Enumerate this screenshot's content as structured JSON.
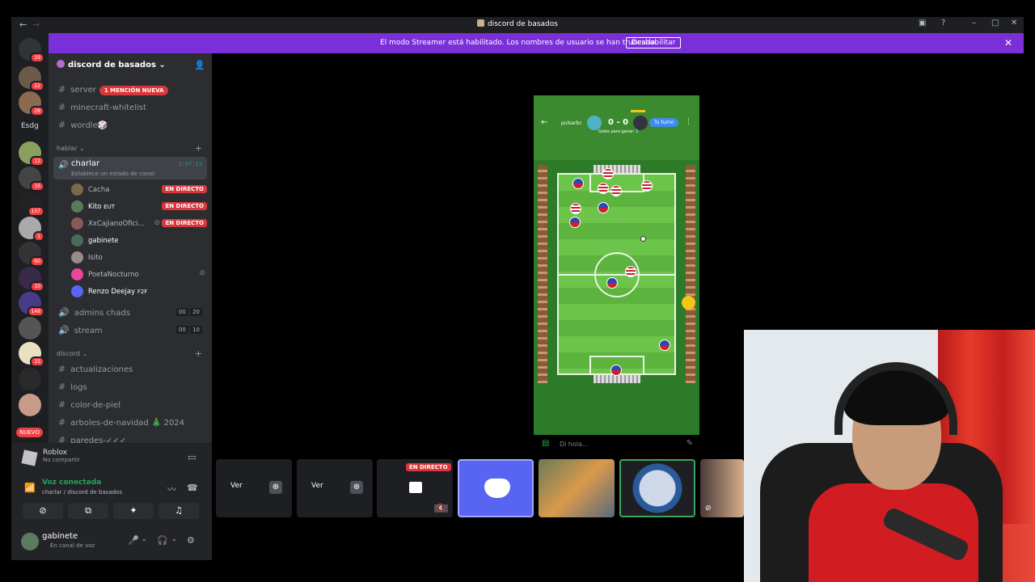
{
  "window": {
    "title": "discord de basados"
  },
  "banner": {
    "message": "El modo Streamer está habilitado. Los nombres de usuario se han truncado.",
    "button": "Deshabilitar"
  },
  "servers": {
    "badges": [
      "19",
      "22",
      "28",
      "12",
      "16",
      "157",
      "1",
      "60",
      "10",
      "148",
      "15"
    ],
    "text_item": "Esdg",
    "new_label": "NUEVO"
  },
  "guild": {
    "name": "discord de basados"
  },
  "channels": {
    "top": [
      {
        "name": "server",
        "mention": "1 MENCIÓN NUEVA"
      },
      {
        "name": "minecraft-whitelist"
      },
      {
        "name": "wordle🎲"
      }
    ],
    "category_hablar": "hablar",
    "voice_active": {
      "name": "charlar",
      "status": "Establece un estado de canal",
      "time": "1:07:21"
    },
    "voice_users": [
      {
        "name": "Cacha",
        "live": "EN DIRECTO"
      },
      {
        "name": "Kito",
        "tag": "EUT",
        "live": "EN DIRECTO"
      },
      {
        "name": "XxCajianoOfici...",
        "live": "EN DIRECTO"
      },
      {
        "name": "gabinete"
      },
      {
        "name": "Isito"
      },
      {
        "name": "PoetaNocturno"
      },
      {
        "name": "Renzo Deejay",
        "tag": "F2F"
      }
    ],
    "voice_others": [
      {
        "name": "admins chads",
        "a": "00",
        "b": "20"
      },
      {
        "name": "stream",
        "a": "00",
        "b": "10"
      }
    ],
    "category_discord": "discord",
    "discord_channels": [
      "actualizaciones",
      "logs",
      "color-de-piel",
      "arboles-de-navidad 🎄 2024",
      "paredes-✓✓✓"
    ]
  },
  "activity": {
    "name": "Roblox",
    "sub": "No compartir"
  },
  "voice_connected": {
    "title": "Voz conectada",
    "sub": "charlar / discord de basados"
  },
  "user": {
    "name": "gabinete",
    "status": "En canal de voz"
  },
  "game": {
    "player_left": "pulsarbc",
    "score": "0 - 0",
    "turn": "Tu turno",
    "sub": "Goles para ganar: 1",
    "chat_placeholder": "Di hola..."
  },
  "tiles": {
    "ver_label": "Ver",
    "live_label": "EN DIRECTO"
  },
  "colors": {
    "blurple": "#5865f2",
    "banner": "#7b2fd9",
    "live": "#da373c",
    "green": "#23a55a"
  }
}
